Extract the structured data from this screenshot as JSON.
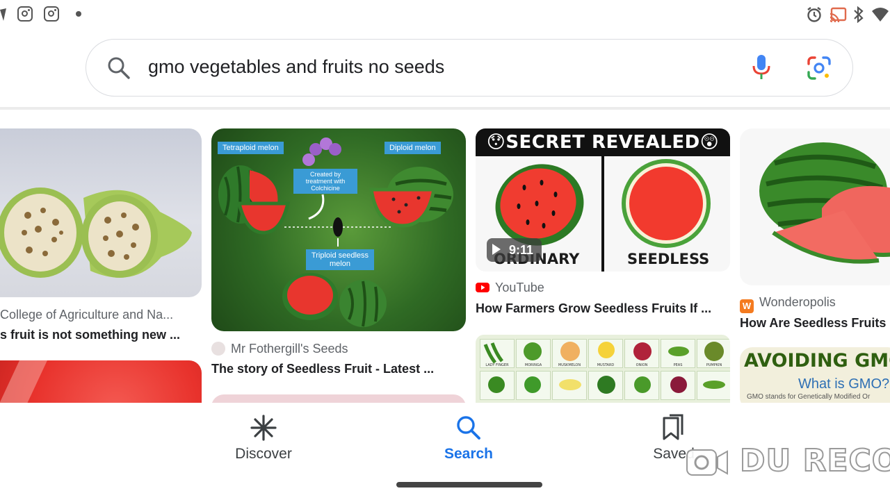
{
  "search": {
    "query": "gmo vegetables and fruits no seeds"
  },
  "results": [
    {
      "source": "College of Agriculture and Na...",
      "title": "s fruit is not something new ..."
    },
    {
      "source": "Mr Fothergill's Seeds",
      "title": "The story of Seedless Fruit - Latest ...",
      "image_labels": {
        "tetraploid": "Tetraploid melon",
        "diploid": "Diploid melon",
        "colchicine": "Created by treatment with Colchicine",
        "triploid": "Triploid seedless melon"
      }
    },
    {
      "source": "YouTube",
      "title": "How Farmers Grow Seedless Fruits If ...",
      "video_duration": "9:11",
      "image_labels": {
        "banner": "😯SECRET REVEALED😲",
        "left": "ORDINARY",
        "right": "SEEDLESS"
      }
    },
    {
      "source": "Wonderopolis",
      "title": "How Are Seedless Fruits"
    },
    {
      "image_labels": {
        "title": "AVOIDING GMO FRUI",
        "subtitle": "What is GMO?",
        "note": "GMO stands for Genetically Modified Or"
      }
    }
  ],
  "veg_chart": [
    "LADY FINGER",
    "MORINGA",
    "MUSKMELON",
    "MUSTARD",
    "ONION",
    "PEAS",
    "PUMPKIN"
  ],
  "nav": {
    "discover": "Discover",
    "search": "Search",
    "saved": "Saved"
  },
  "watermark": "DU RECO",
  "colors": {
    "accent": "#1a73e8",
    "youtube": "#ff0000",
    "wonderopolis": "#f47b20"
  }
}
